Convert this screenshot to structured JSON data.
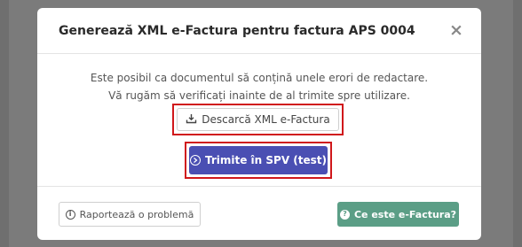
{
  "modal": {
    "title": "Generează XML e-Factura pentru factura APS 0004",
    "close_symbol": "×"
  },
  "body": {
    "message_line1": "Este posibil ca documentul să conțină unele erori de redactare.",
    "message_line2": "Vă rugăm să verificați inainte de al trimite spre utilizare.",
    "download_label": "Descarcă XML e-Factura",
    "send_label": "Trimite în SPV (test)"
  },
  "footer": {
    "report_label": "Raportează o problemă",
    "info_label": "Ce este e-Factura?",
    "info_glyph": "?"
  },
  "icons": {
    "download": "download-tray-icon",
    "send": "circle-arrow-right-icon",
    "report": "info-circle-icon",
    "info": "question-circle-icon",
    "close": "close-icon"
  },
  "colors": {
    "primary": "#4a4fb3",
    "success": "#5b9e86",
    "highlight": "#d0181b"
  }
}
